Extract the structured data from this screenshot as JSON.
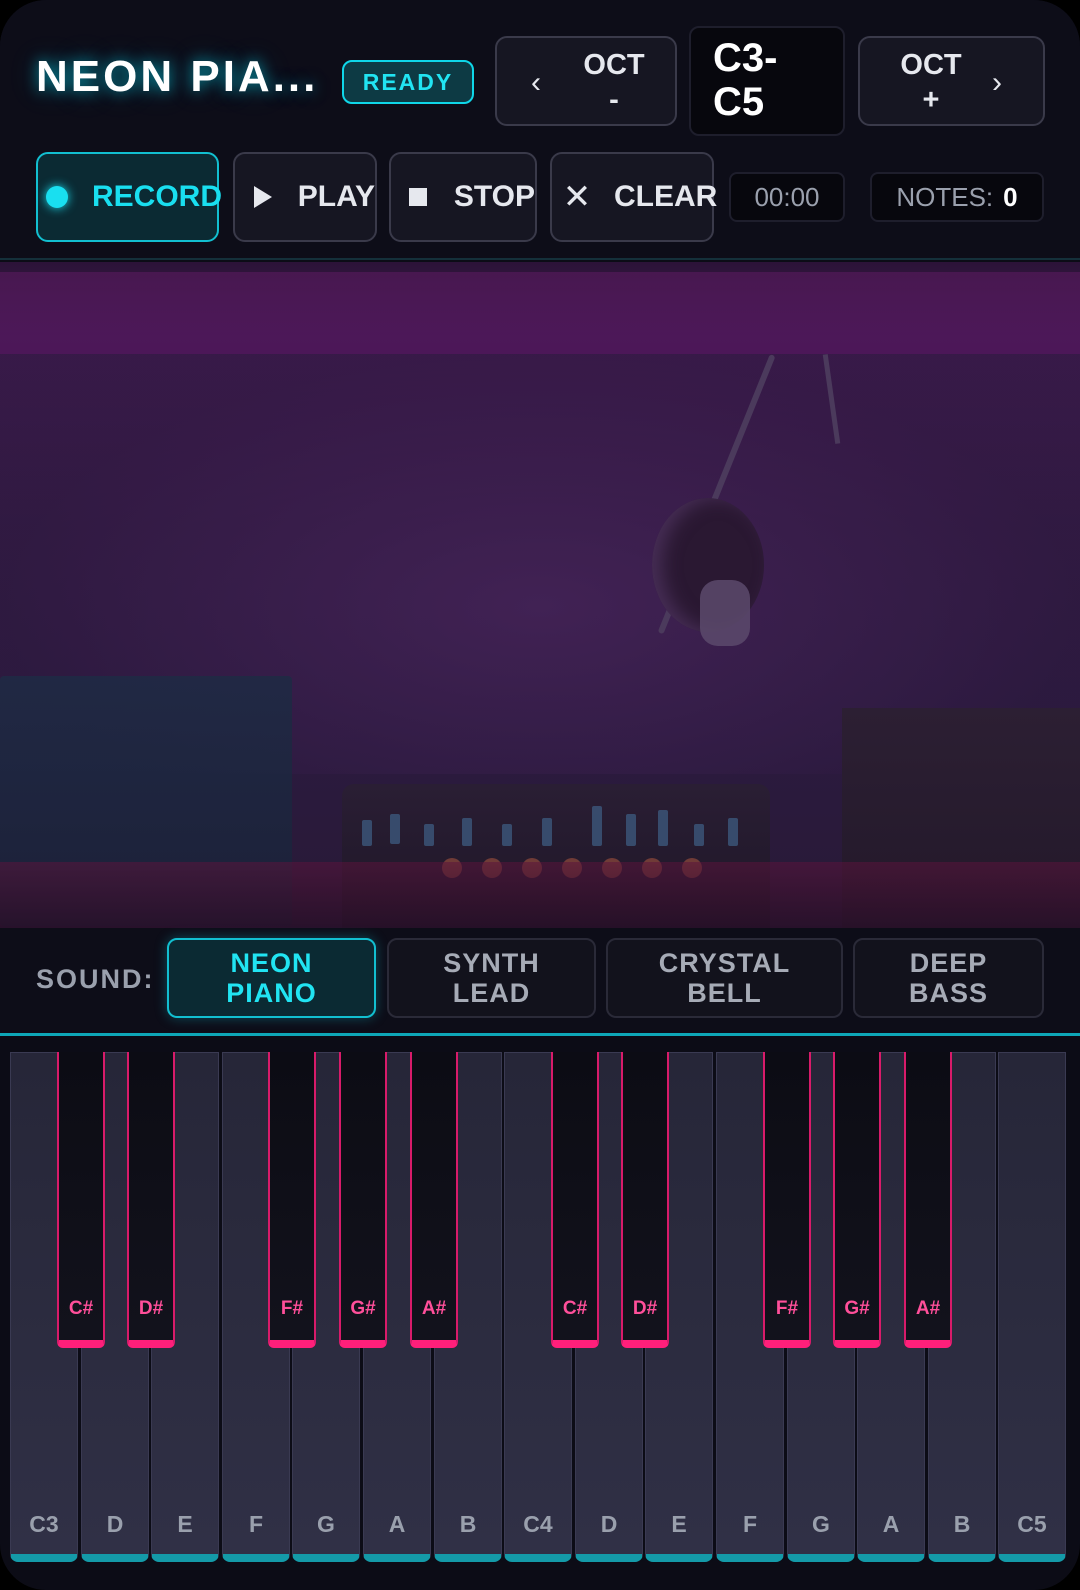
{
  "header": {
    "title": "NEON PIA...",
    "status": "READY",
    "octave_down_label": "OCT\n-",
    "octave_up_label": "OCT\n+",
    "range_label": "C3-\nC5"
  },
  "transport": {
    "record_label": "RECORD",
    "play_label": "PLAY",
    "stop_label": "STOP",
    "clear_label": "CLEAR",
    "timer": "00:00",
    "notes_label": "NOTES:",
    "notes_count": "0"
  },
  "sound": {
    "label": "SOUND:",
    "options": [
      "NEON PIANO",
      "SYNTH LEAD",
      "CRYSTAL BELL",
      "DEEP BASS"
    ],
    "selected": "NEON PIANO"
  },
  "keyboard": {
    "white_keys": [
      "C3",
      "D",
      "E",
      "F",
      "G",
      "A",
      "B",
      "C4",
      "D",
      "E",
      "F",
      "G",
      "A",
      "B",
      "C5"
    ],
    "black_keys": [
      "C#",
      "D#",
      "F#",
      "G#",
      "A#",
      "C#",
      "D#",
      "F#",
      "G#",
      "A#"
    ]
  },
  "colors": {
    "accent": "#19dff0",
    "black_key_accent": "#ff1f7a",
    "background": "#0c0c16"
  },
  "icons": {
    "octave_down": "chevron-left-icon",
    "octave_up": "chevron-right-icon",
    "record": "record-dot-icon",
    "play": "play-icon",
    "stop": "stop-icon",
    "clear": "close-icon"
  }
}
